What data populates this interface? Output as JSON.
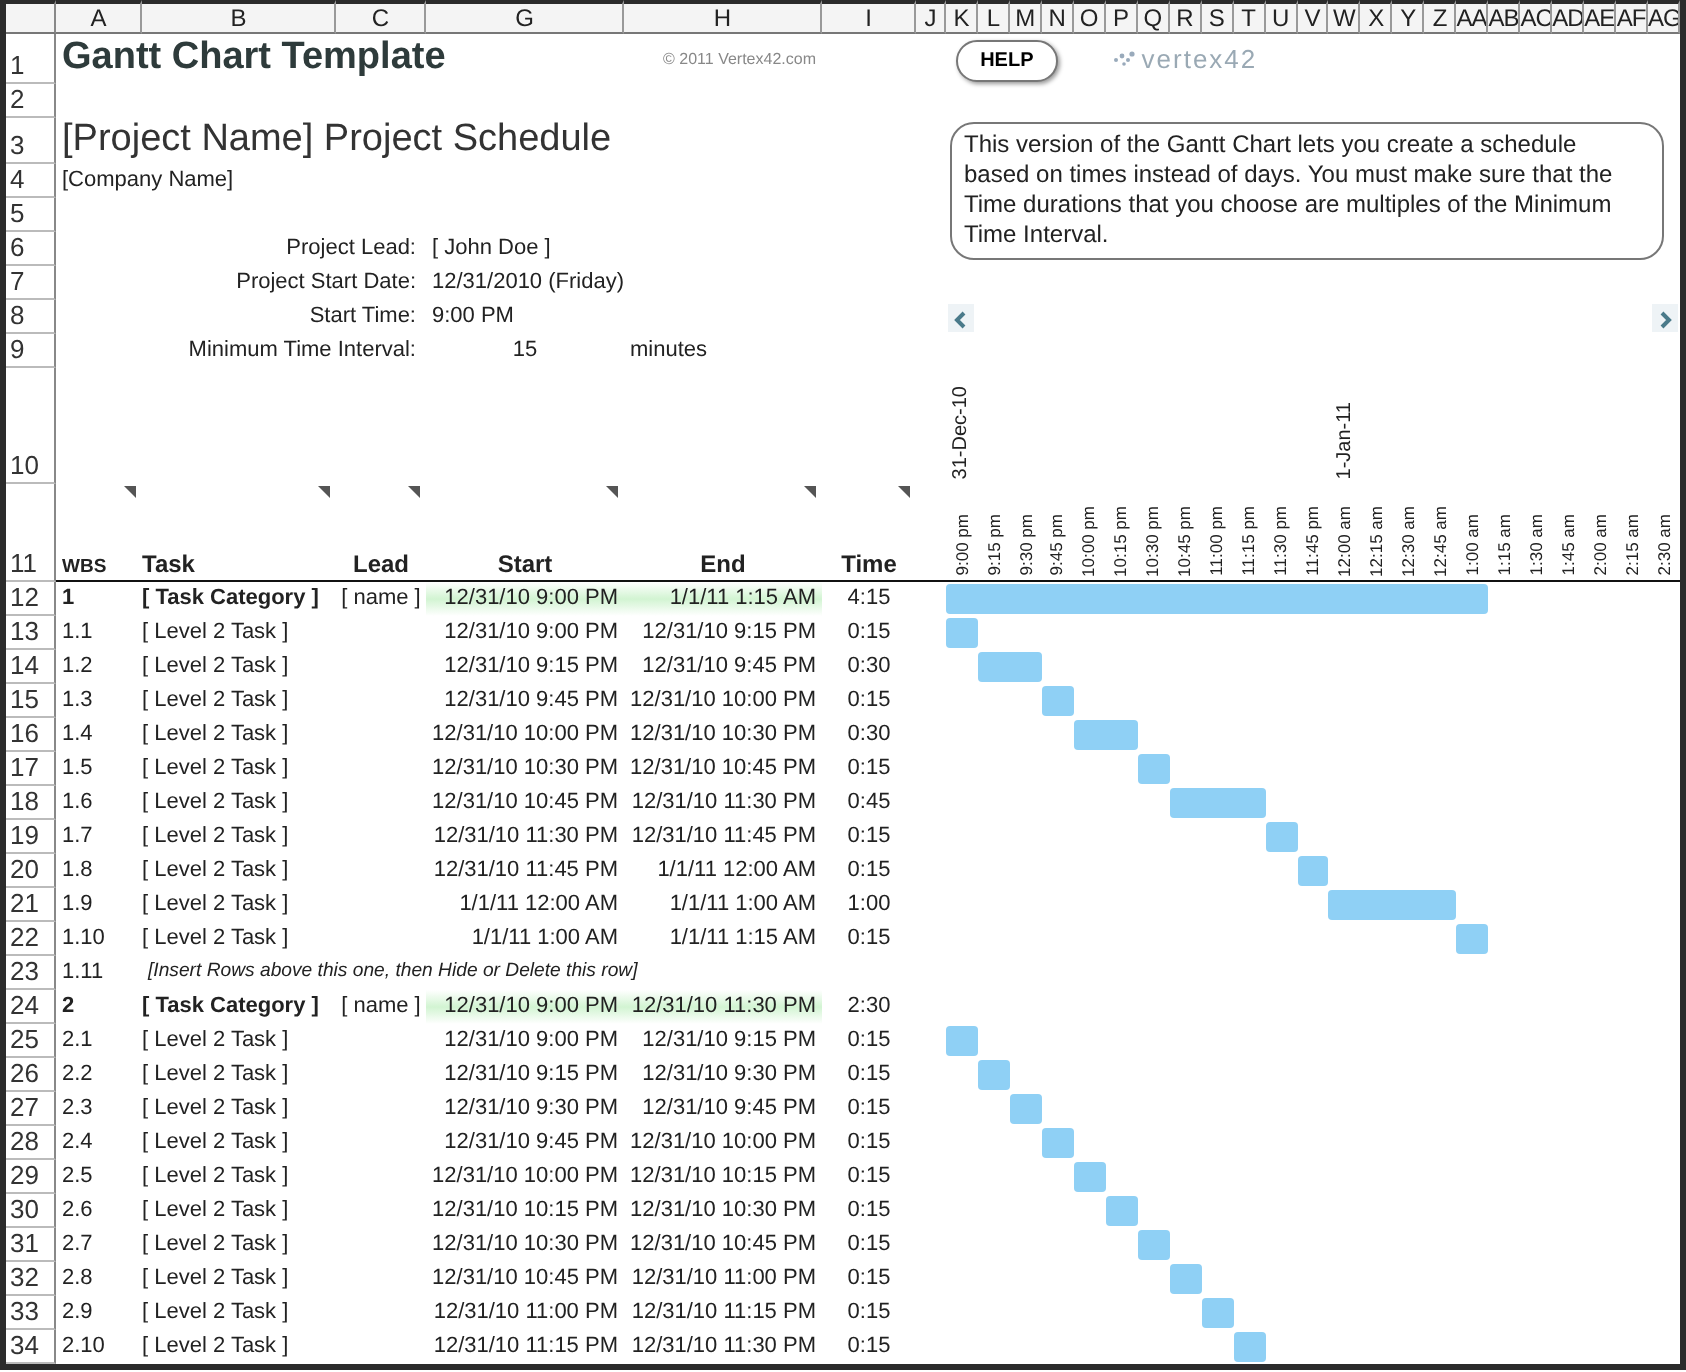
{
  "column_headers": [
    "A",
    "B",
    "C",
    "G",
    "H",
    "I",
    "J",
    "K",
    "L",
    "M",
    "N",
    "O",
    "P",
    "Q",
    "R",
    "S",
    "T",
    "U",
    "V",
    "W",
    "X",
    "Y",
    "Z",
    "AA",
    "AB",
    "AC",
    "AD",
    "AE",
    "AF",
    "AG"
  ],
  "row_headers": [
    "1",
    "2",
    "3",
    "4",
    "5",
    "6",
    "7",
    "8",
    "9",
    "10",
    "11",
    "12",
    "13",
    "14",
    "15",
    "16",
    "17",
    "18",
    "19",
    "20",
    "21",
    "22",
    "23",
    "24",
    "25",
    "26",
    "27",
    "28",
    "29",
    "30",
    "31",
    "32",
    "33",
    "34"
  ],
  "title": "Gantt Chart Template",
  "copyright": "© 2011 Vertex42.com",
  "help_button": "HELP",
  "logo_text": "vertex42",
  "project_title": "[Project Name] Project Schedule",
  "company": "[Company Name]",
  "note": "This version of the Gantt Chart lets you create a schedule based on times instead of days. You must make sure that the Time durations that you choose are multiples of the Minimum Time Interval.",
  "info": [
    {
      "label": "Project Lead:",
      "value": "[ John Doe ]"
    },
    {
      "label": "Project Start Date:",
      "value": "12/31/2010 (Friday)"
    },
    {
      "label": "Start Time:",
      "value": "9:00 PM"
    },
    {
      "label": "Minimum Time Interval:",
      "value": "15",
      "unit": "minutes"
    }
  ],
  "timeline": [
    {
      "time": "9:00 pm",
      "date": "31-Dec-10"
    },
    {
      "time": "9:15 pm"
    },
    {
      "time": "9:30 pm"
    },
    {
      "time": "9:45 pm"
    },
    {
      "time": "10:00 pm"
    },
    {
      "time": "10:15 pm"
    },
    {
      "time": "10:30 pm"
    },
    {
      "time": "10:45 pm"
    },
    {
      "time": "11:00 pm"
    },
    {
      "time": "11:15 pm"
    },
    {
      "time": "11:30 pm"
    },
    {
      "time": "11:45 pm"
    },
    {
      "time": "12:00 am",
      "date": "1-Jan-11"
    },
    {
      "time": "12:15 am"
    },
    {
      "time": "12:30 am"
    },
    {
      "time": "12:45 am"
    },
    {
      "time": "1:00 am"
    },
    {
      "time": "1:15 am"
    },
    {
      "time": "1:30 am"
    },
    {
      "time": "1:45 am"
    },
    {
      "time": "2:00 am"
    },
    {
      "time": "2:15 am"
    },
    {
      "time": "2:30 am"
    }
  ],
  "table": {
    "columns": [
      "WBS",
      "Task",
      "Lead",
      "Start",
      "End",
      "Time"
    ],
    "rows": [
      {
        "kind": "category",
        "wbs": "1",
        "task": "[ Task Category ]",
        "lead": "[ name ]",
        "start": "12/31/10 9:00 PM",
        "end": "1/1/11 1:15 AM",
        "time": "4:15",
        "bar": true
      },
      {
        "kind": "task",
        "wbs": "1.1",
        "task": "[ Level 2 Task ]",
        "start": "12/31/10 9:00 PM",
        "end": "12/31/10 9:15 PM",
        "time": "0:15",
        "bar": true
      },
      {
        "kind": "task",
        "wbs": "1.2",
        "task": "[ Level 2 Task ]",
        "start": "12/31/10 9:15 PM",
        "end": "12/31/10 9:45 PM",
        "time": "0:30",
        "bar": true
      },
      {
        "kind": "task",
        "wbs": "1.3",
        "task": "[ Level 2 Task ]",
        "start": "12/31/10 9:45 PM",
        "end": "12/31/10 10:00 PM",
        "time": "0:15",
        "bar": true
      },
      {
        "kind": "task",
        "wbs": "1.4",
        "task": "[ Level 2 Task ]",
        "start": "12/31/10 10:00 PM",
        "end": "12/31/10 10:30 PM",
        "time": "0:30",
        "bar": true
      },
      {
        "kind": "task",
        "wbs": "1.5",
        "task": "[ Level 2 Task ]",
        "start": "12/31/10 10:30 PM",
        "end": "12/31/10 10:45 PM",
        "time": "0:15",
        "bar": true
      },
      {
        "kind": "task",
        "wbs": "1.6",
        "task": "[ Level 2 Task ]",
        "start": "12/31/10 10:45 PM",
        "end": "12/31/10 11:30 PM",
        "time": "0:45",
        "bar": true
      },
      {
        "kind": "task",
        "wbs": "1.7",
        "task": "[ Level 2 Task ]",
        "start": "12/31/10 11:30 PM",
        "end": "12/31/10 11:45 PM",
        "time": "0:15",
        "bar": true
      },
      {
        "kind": "task",
        "wbs": "1.8",
        "task": "[ Level 2 Task ]",
        "start": "12/31/10 11:45 PM",
        "end": "1/1/11 12:00 AM",
        "time": "0:15",
        "bar": true
      },
      {
        "kind": "task",
        "wbs": "1.9",
        "task": "[ Level 2 Task ]",
        "start": "1/1/11 12:00 AM",
        "end": "1/1/11 1:00 AM",
        "time": "1:00",
        "bar": true
      },
      {
        "kind": "task",
        "wbs": "1.10",
        "task": "[ Level 2 Task ]",
        "start": "1/1/11 1:00 AM",
        "end": "1/1/11 1:15 AM",
        "time": "0:15",
        "bar": true
      },
      {
        "kind": "note",
        "wbs": "1.11",
        "task": "[Insert Rows above this one, then Hide or Delete this row]"
      },
      {
        "kind": "category",
        "wbs": "2",
        "task": "[ Task Category ]",
        "lead": "[ name ]",
        "start": "12/31/10 9:00 PM",
        "end": "12/31/10 11:30 PM",
        "time": "2:30",
        "bar": false
      },
      {
        "kind": "task",
        "wbs": "2.1",
        "task": "[ Level 2 Task ]",
        "start": "12/31/10 9:00 PM",
        "end": "12/31/10 9:15 PM",
        "time": "0:15",
        "bar": true
      },
      {
        "kind": "task",
        "wbs": "2.2",
        "task": "[ Level 2 Task ]",
        "start": "12/31/10 9:15 PM",
        "end": "12/31/10 9:30 PM",
        "time": "0:15",
        "bar": true
      },
      {
        "kind": "task",
        "wbs": "2.3",
        "task": "[ Level 2 Task ]",
        "start": "12/31/10 9:30 PM",
        "end": "12/31/10 9:45 PM",
        "time": "0:15",
        "bar": true
      },
      {
        "kind": "task",
        "wbs": "2.4",
        "task": "[ Level 2 Task ]",
        "start": "12/31/10 9:45 PM",
        "end": "12/31/10 10:00 PM",
        "time": "0:15",
        "bar": true
      },
      {
        "kind": "task",
        "wbs": "2.5",
        "task": "[ Level 2 Task ]",
        "start": "12/31/10 10:00 PM",
        "end": "12/31/10 10:15 PM",
        "time": "0:15",
        "bar": true
      },
      {
        "kind": "task",
        "wbs": "2.6",
        "task": "[ Level 2 Task ]",
        "start": "12/31/10 10:15 PM",
        "end": "12/31/10 10:30 PM",
        "time": "0:15",
        "bar": true
      },
      {
        "kind": "task",
        "wbs": "2.7",
        "task": "[ Level 2 Task ]",
        "start": "12/31/10 10:30 PM",
        "end": "12/31/10 10:45 PM",
        "time": "0:15",
        "bar": true
      },
      {
        "kind": "task",
        "wbs": "2.8",
        "task": "[ Level 2 Task ]",
        "start": "12/31/10 10:45 PM",
        "end": "12/31/10 11:00 PM",
        "time": "0:15",
        "bar": true
      },
      {
        "kind": "task",
        "wbs": "2.9",
        "task": "[ Level 2 Task ]",
        "start": "12/31/10 11:00 PM",
        "end": "12/31/10 11:15 PM",
        "time": "0:15",
        "bar": true
      },
      {
        "kind": "task",
        "wbs": "2.10",
        "task": "[ Level 2 Task ]",
        "start": "12/31/10 11:15 PM",
        "end": "12/31/10 11:30 PM",
        "time": "0:15",
        "bar": true
      }
    ]
  }
}
